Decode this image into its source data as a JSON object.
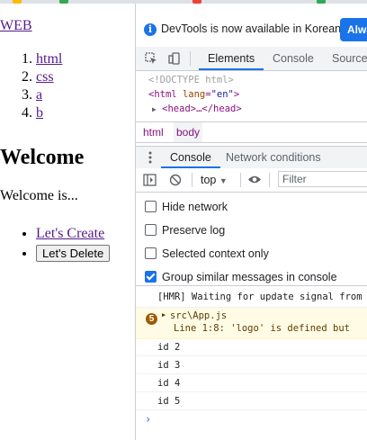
{
  "page": {
    "site_link": "WEB",
    "nav_items": [
      "html",
      "css",
      "a",
      "b"
    ],
    "heading": "Welcome",
    "body_text": "Welcome is...",
    "create_link": "Let's Create",
    "delete_button": "Let's Delete"
  },
  "devtools": {
    "infobar": {
      "text": "DevTools is now available in Korean!",
      "button": "Alway"
    },
    "main_tabs": [
      "Elements",
      "Console",
      "Sources"
    ],
    "active_tab": "Elements",
    "dom": {
      "doctype": "<!DOCTYPE html>",
      "html_open_tag": "<html",
      "html_attr": "lang",
      "html_attr_eq": "=",
      "html_attr_value": "\"en\"",
      "html_close_bracket": ">",
      "head_collapsed": "<head>…</head>"
    },
    "breadcrumbs": [
      "html",
      "body"
    ],
    "drawer_tabs": [
      "Console",
      "Network conditions"
    ],
    "active_drawer_tab": "Console",
    "context": "top",
    "filter_placeholder": "Filter",
    "settings": [
      {
        "label": "Hide network",
        "checked": false
      },
      {
        "label": "Preserve log",
        "checked": false
      },
      {
        "label": "Selected context only",
        "checked": false
      },
      {
        "label": "Group similar messages in console",
        "checked": true
      }
    ],
    "messages": {
      "hmr": "[HMR] Waiting for update signal from",
      "warn_count": "5",
      "warn_file": "src\\App.js",
      "warn_detail": "Line 1:8:  'logo' is defined but",
      "ids": [
        "id 2",
        "id 3",
        "id 4",
        "id 5"
      ],
      "prompt": "›"
    }
  },
  "colors": {
    "link_visited": "#551a8b",
    "accent": "#1a73e8",
    "warning_bg": "#fffbe5"
  }
}
